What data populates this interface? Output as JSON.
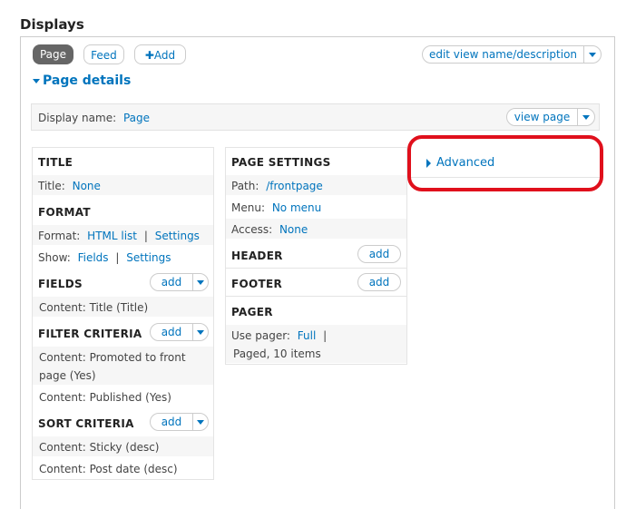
{
  "heading": "Displays",
  "tabs": {
    "page": "Page",
    "feed": "Feed",
    "add_icon": "plus-icon",
    "add": "Add"
  },
  "edit_view_button": "edit view name/description",
  "page_details": "Page details",
  "display_name": {
    "label": "Display name:",
    "value": "Page"
  },
  "view_page_button": "view page",
  "left": {
    "title_h": "TITLE",
    "title_label": "Title:",
    "title_value": "None",
    "format_h": "FORMAT",
    "format_label": "Format:",
    "format_value": "HTML list",
    "sep": "|",
    "format_settings": "Settings",
    "show_label": "Show:",
    "show_value": "Fields",
    "show_settings": "Settings",
    "fields_h": "FIELDS",
    "add": "add",
    "fields_item": "Content: Title (Title)",
    "filter_h": "FILTER CRITERIA",
    "filter_item1_a": "Content: Promoted to front",
    "filter_item1_b": "page (Yes)",
    "filter_item2": "Content: Published (Yes)",
    "sort_h": "SORT CRITERIA",
    "sort_item1": "Content: Sticky (desc)",
    "sort_item2": "Content: Post date (desc)"
  },
  "middle": {
    "page_settings_h": "PAGE SETTINGS",
    "path_label": "Path:",
    "path_value": "/frontpage",
    "menu_label": "Menu:",
    "menu_value": "No menu",
    "access_label": "Access:",
    "access_value": "None",
    "header_h": "HEADER",
    "footer_h": "FOOTER",
    "add": "add",
    "pager_h": "PAGER",
    "use_pager_label": "Use pager:",
    "use_pager_value": "Full",
    "sep": "|",
    "pager_detail": "Paged, 10 items"
  },
  "advanced": "Advanced",
  "colors": {
    "link": "#0074bd",
    "highlight": "#e0101c",
    "active_tab": "#666666"
  }
}
